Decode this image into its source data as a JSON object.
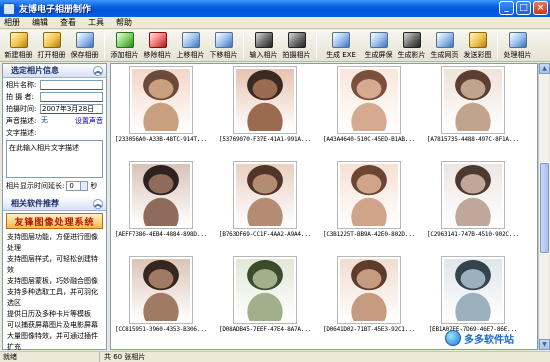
{
  "window": {
    "title": "友博电子相册制作"
  },
  "menu": [
    "相册",
    "编辑",
    "查看",
    "工具",
    "帮助"
  ],
  "toolbar": [
    {
      "label": "新建相册",
      "icon": "new-album-icon",
      "color": "gold"
    },
    {
      "label": "打开相册",
      "icon": "open-album-icon",
      "color": "gold"
    },
    {
      "label": "保存相册",
      "icon": "save-album-icon",
      "color": ""
    },
    {
      "label": "添加相片",
      "icon": "add-photo-icon",
      "color": "green"
    },
    {
      "label": "移除相片",
      "icon": "remove-photo-icon",
      "color": "red"
    },
    {
      "label": "上移相片",
      "icon": "move-up-icon",
      "color": ""
    },
    {
      "label": "下移相片",
      "icon": "move-down-icon",
      "color": ""
    },
    {
      "label": "输入相片",
      "icon": "import-photo-icon",
      "color": "dark"
    },
    {
      "label": "拍摄相片",
      "icon": "camera-icon",
      "color": "dark"
    },
    {
      "label": "生成 EXE",
      "icon": "build-exe-icon",
      "color": ""
    },
    {
      "label": "生成屏保",
      "icon": "build-screensaver-icon",
      "color": ""
    },
    {
      "label": "生成影片",
      "icon": "build-movie-icon",
      "color": "dark"
    },
    {
      "label": "生成网页",
      "icon": "build-webpage-icon",
      "color": ""
    },
    {
      "label": "发送彩图",
      "icon": "send-mms-icon",
      "color": "gold"
    },
    {
      "label": "处理相片",
      "icon": "process-photo-icon",
      "color": ""
    }
  ],
  "info_panel": {
    "title": "选定相片信息",
    "name_label": "相片名称:",
    "name_value": "",
    "photographer_label": "拍 摄 者:",
    "photographer_value": "",
    "date_label": "拍摄时间:",
    "date_value": "2007年3月28日",
    "sound_label": "声音描述:",
    "sound_value": "无",
    "sound_link": "设置声音",
    "text_label": "文字描述:",
    "text_value": "在此输入相片文字描述",
    "delay_label": "相片显示时间延长:",
    "delay_value": "0",
    "delay_unit": "秒"
  },
  "soft_panel": {
    "title": "相关软件推荐",
    "banner": "友锋图像处理系统",
    "items": [
      "支持图层功能，方便进行图像处理",
      "支持图层样式，可轻松创建特效",
      "支持图层蒙板，巧妙融合图像",
      "支持多种选取工具，并可羽化选区",
      "提供日历及多种卡片等模板",
      "可以捕获屏幕图片及电影屏幕",
      "大量图像特效，并可通过插件扩充"
    ]
  },
  "photos": [
    {
      "caption": "[233056A0-A33B-48TC-914T..."
    },
    {
      "caption": "[53769070-F37E-41A1-991A..."
    },
    {
      "caption": "[A43A4640-510C-45ED-B1AB..."
    },
    {
      "caption": "[A7815735-4488-497C-8F1A..."
    },
    {
      "caption": "[AEFF7386-4EB4-4884-898D..."
    },
    {
      "caption": "[B763DF69-CC1F-4AA2-A9A4..."
    },
    {
      "caption": "[C3B1225T-BB9A-42E0-802D..."
    },
    {
      "caption": "[C2963141-747B-4510-902C..."
    },
    {
      "caption": "[CC815951-3960-4353-B306..."
    },
    {
      "caption": "[D08ADB45-7EEF-47E4-8A7A..."
    },
    {
      "caption": "[D0641D02-71BT-45E3-92C1..."
    },
    {
      "caption": "[EB1A07EE-7D69-46E7-86E..."
    }
  ],
  "watermark": "多多软件站",
  "status": {
    "left": "就绪",
    "count": "共 60 张相片"
  }
}
